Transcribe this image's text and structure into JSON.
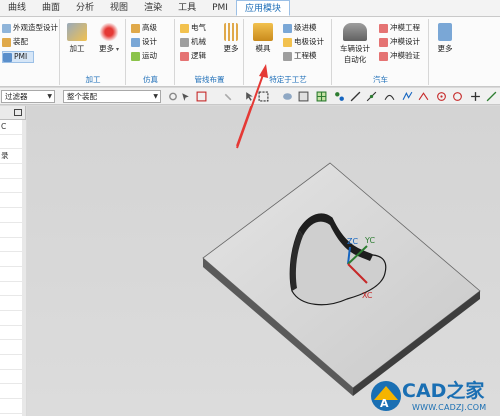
{
  "menu": {
    "items": [
      "曲线",
      "曲面",
      "分析",
      "视图",
      "渲染",
      "工具",
      "PMI",
      "应用模块"
    ],
    "active_index": 7
  },
  "ribbon": {
    "design": {
      "items": [
        "外观造型设计",
        "装配",
        "PMI"
      ]
    },
    "machining": {
      "button": "加工",
      "more": "更多",
      "label": "加工"
    },
    "simulation": {
      "items": [
        "高级",
        "设计",
        "运动"
      ],
      "label": "仿真"
    },
    "routing": {
      "items": [
        "电气",
        "机械",
        "逻辑"
      ],
      "more": "更多",
      "label": "管线布置"
    },
    "process": {
      "button": "模具",
      "items": [
        "级进模",
        "电极设计",
        "工程模"
      ],
      "label": "特定于工艺"
    },
    "auto": {
      "button_line1": "车辆设计",
      "button_line2": "自动化",
      "items": [
        "冲模工程",
        "冲模设计",
        "冲模验证"
      ],
      "label": "汽车"
    },
    "more": {
      "label": "更多"
    }
  },
  "toolbar": {
    "filter_value": "过滤器",
    "scope_value": "整个装配"
  },
  "navigator": {
    "rows": [
      "C",
      "",
      "录",
      "",
      "",
      "",
      "",
      "",
      "",
      "",
      "",
      "",
      "",
      "",
      "",
      "",
      "",
      "",
      "",
      ""
    ]
  },
  "viewport": {
    "axis_labels": {
      "zc": "ZC",
      "yc": "YC",
      "xc": "XC"
    }
  },
  "logo": {
    "text": "CAD之家",
    "url": "WWW.CADZJ.COM",
    "watermark": "A"
  },
  "colors": {
    "accent": "#1f6fb8",
    "annotation_arrow": "#e53935",
    "axis_z": "#1565c0",
    "axis_y": "#2e7d32",
    "axis_x": "#c62828"
  }
}
